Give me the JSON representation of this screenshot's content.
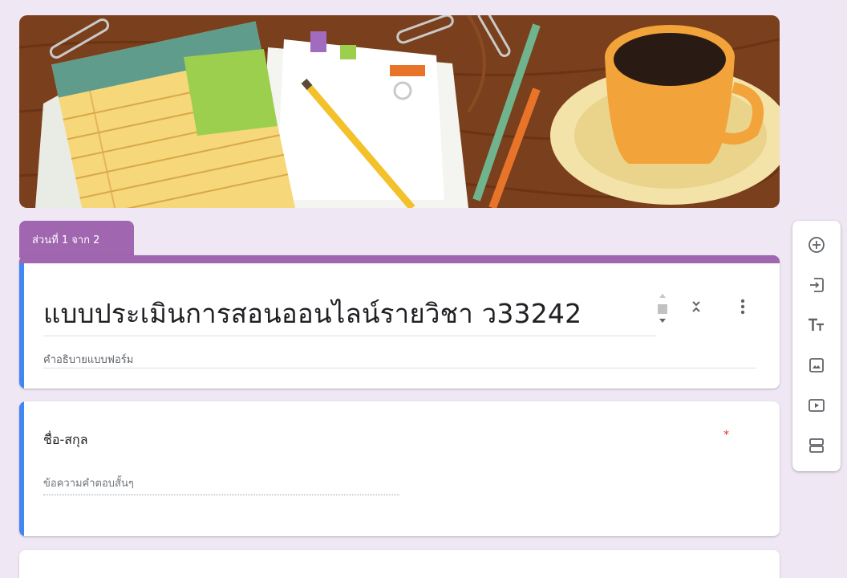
{
  "section": {
    "tab_label": "ส่วนที่ 1 จาก 2"
  },
  "form": {
    "title": "แบบประเมินการสอนออนไลน์รายวิชา ว33242",
    "description_placeholder": "คำอธิบายแบบฟอร์ม"
  },
  "question": {
    "title": "ชื่อ-สกุล",
    "required_mark": "*",
    "answer_placeholder": "ข้อความคำตอบสั้นๆ"
  },
  "toolbar": {
    "items": [
      {
        "name": "add-question",
        "icon": "plus-circle-icon"
      },
      {
        "name": "import-questions",
        "icon": "import-icon"
      },
      {
        "name": "add-title",
        "icon": "text-icon"
      },
      {
        "name": "add-image",
        "icon": "image-icon"
      },
      {
        "name": "add-video",
        "icon": "video-icon"
      },
      {
        "name": "add-section",
        "icon": "section-icon"
      }
    ]
  },
  "colors": {
    "theme": "#a066b0",
    "background": "#efe7f3",
    "focus_bar": "#4285f4",
    "required": "#d93025"
  }
}
